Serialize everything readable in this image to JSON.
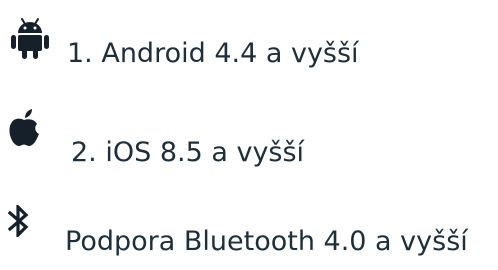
{
  "colors": {
    "text": "#1e2f3c",
    "icon": "#15202b"
  },
  "requirements": [
    {
      "icon": "android-icon",
      "label": "1. Android 4.4 a vyšší"
    },
    {
      "icon": "apple-icon",
      "label": "2. iOS 8.5 a vyšší"
    },
    {
      "icon": "bluetooth-icon",
      "label": "Podpora Bluetooth 4.0 a vyšší"
    }
  ]
}
